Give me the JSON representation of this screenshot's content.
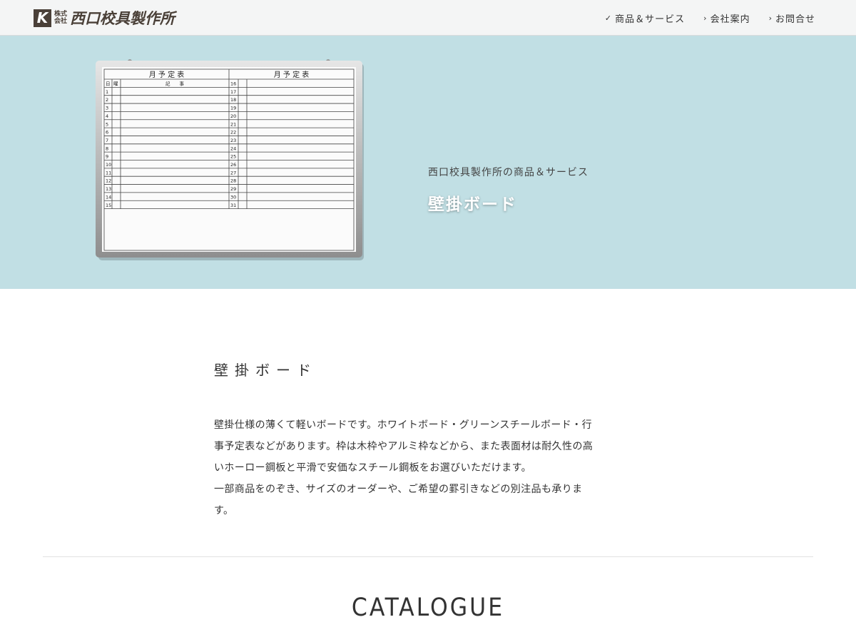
{
  "header": {
    "logo": {
      "mark": "K",
      "type_line1": "株式",
      "type_line2": "会社",
      "name": "西口校具製作所"
    },
    "nav": [
      {
        "icon": "check-icon",
        "glyph": "✓",
        "label": "商品＆サービス"
      },
      {
        "icon": "chevron-right-icon",
        "glyph": "›",
        "label": "会社案内"
      },
      {
        "icon": "chevron-right-icon",
        "glyph": "›",
        "label": "お問合せ"
      }
    ]
  },
  "hero": {
    "background": "#c1dfe4",
    "subtitle": "西口校具製作所の商品＆サービス",
    "title": "壁掛ボード",
    "board": {
      "left_title": "月 予 定 表",
      "right_title": "月 予 定 表",
      "col_day": "日",
      "col_weekday": "曜",
      "col_note": "記　　事",
      "left_days": [
        "1",
        "2",
        "3",
        "4",
        "5",
        "6",
        "7",
        "8",
        "9",
        "10",
        "11",
        "12",
        "13",
        "14",
        "15"
      ],
      "right_days": [
        "16",
        "17",
        "18",
        "19",
        "20",
        "21",
        "22",
        "23",
        "24",
        "25",
        "26",
        "27",
        "28",
        "29",
        "30",
        "31"
      ]
    }
  },
  "main": {
    "section_title": "壁掛ボード",
    "description": [
      "壁掛仕様の薄くて軽いボードです。ホワイトボード・グリーンスチールボード・行",
      "事予定表などがあります。枠は木枠やアルミ枠などから、また表面材は耐久性の高",
      "いホーロー鋼板と平滑で安価なスチール鋼板をお選びいただけます。",
      "一部商品をのぞき、サイズのオーダーや、ご希望の罫引きなどの別注品も承りま",
      "す。"
    ],
    "catalogue_heading": "CATALOGUE"
  }
}
